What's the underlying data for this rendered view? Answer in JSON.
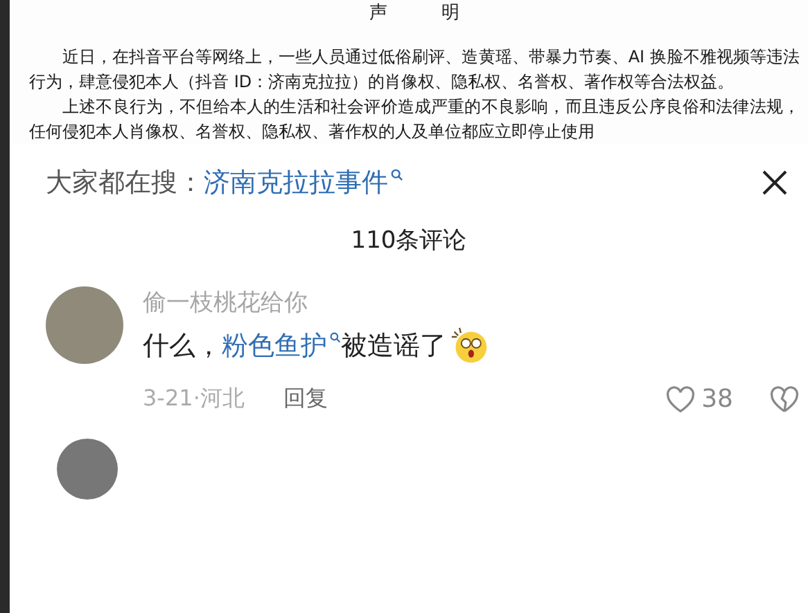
{
  "document": {
    "title": "声　　　明",
    "paragraphs": [
      "近日，在抖音平台等网络上，一些人员通过低俗刷评、造黄瑶、带暴力节奏、AI 换脸不雅视频等违法行为，肆意侵犯本人（抖音 ID：济南克拉拉）的肖像权、隐私权、名誉权、著作权等合法权益。",
      "上述不良行为，不但给本人的生活和社会评价造成严重的不良影响，而且违反公序良俗和法律法规，任何侵犯本人肖像权、名誉权、隐私权、著作权的人及单位都应立即停止使用"
    ]
  },
  "search_bar": {
    "label": "大家都在搜：",
    "query": "济南克拉拉事件"
  },
  "comments_header": "110条评论",
  "comments": [
    {
      "author": "偷一枝桃花给你",
      "segments": [
        {
          "kind": "plain",
          "text": "什么，"
        },
        {
          "kind": "link",
          "text": "粉色鱼护"
        },
        {
          "kind": "plain",
          "text": "被造谣了"
        }
      ],
      "date_location": "3-21·河北",
      "reply": "回复",
      "likes": "38"
    }
  ]
}
